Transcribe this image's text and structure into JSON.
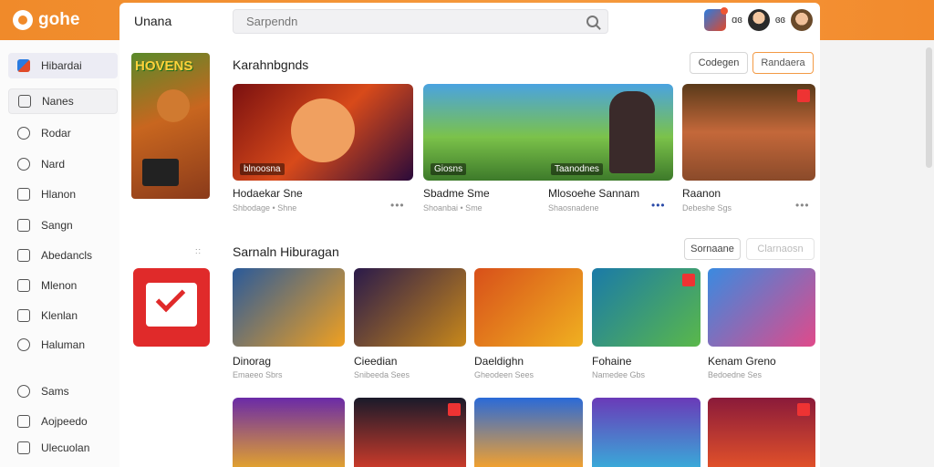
{
  "brand": {
    "name": "gohe"
  },
  "topbar": {
    "title": "Unana",
    "search_placeholder": "Sarpendn",
    "user1_label": "ɑɞ",
    "user2_label": "ɞɞ"
  },
  "sidebar": {
    "items": [
      {
        "label": "Hibardai"
      },
      {
        "label": "Nanes"
      },
      {
        "label": "Rodar"
      },
      {
        "label": "Nard"
      },
      {
        "label": "Hlanon"
      },
      {
        "label": "Sangn"
      },
      {
        "label": "Abedancls"
      },
      {
        "label": "Mlenon"
      },
      {
        "label": "Klenlan"
      },
      {
        "label": "Haluman"
      },
      {
        "label": "Sams"
      },
      {
        "label": "Aojpeedo"
      },
      {
        "label": "Ulecuolan"
      }
    ]
  },
  "section1": {
    "title": "Karahnbgnds",
    "btn1": "Codegen",
    "btn2": "Randaera",
    "promo_title": "HOVENS",
    "tiles": [
      {
        "overlay": "blnoosna",
        "title": "Hodaekar Sne",
        "meta": "Shbodage • Shne"
      },
      {
        "overlay": "Giosns",
        "title": "Sbadme Sme",
        "meta": "Shoanbai • Sme"
      },
      {
        "overlay": "Taanodnes",
        "title": "Mlosoehe Sannam",
        "meta": "Shaosnadene"
      },
      {
        "overlay": "",
        "title": "Raanon",
        "meta": "Debeshe Sgs"
      }
    ]
  },
  "section2": {
    "title": "Sarnaln Hiburagan",
    "btn1": "Sornaane",
    "btn2": "Clarnaosn",
    "tiles_row1": [
      {
        "title": "Dinorag",
        "meta": "Emaeeo Sbrs"
      },
      {
        "title": "Cieedian",
        "meta": "Snibeeda Sees"
      },
      {
        "title": "Daeldighn",
        "meta": "Gheodeen Sees"
      },
      {
        "title": "Fohaine",
        "meta": "Namedee Gbs"
      },
      {
        "title": "Kenam Greno",
        "meta": "Bedoedne Ses"
      }
    ]
  },
  "colors": {
    "accent": "#f08a2a",
    "button_border": "#f39a45"
  }
}
